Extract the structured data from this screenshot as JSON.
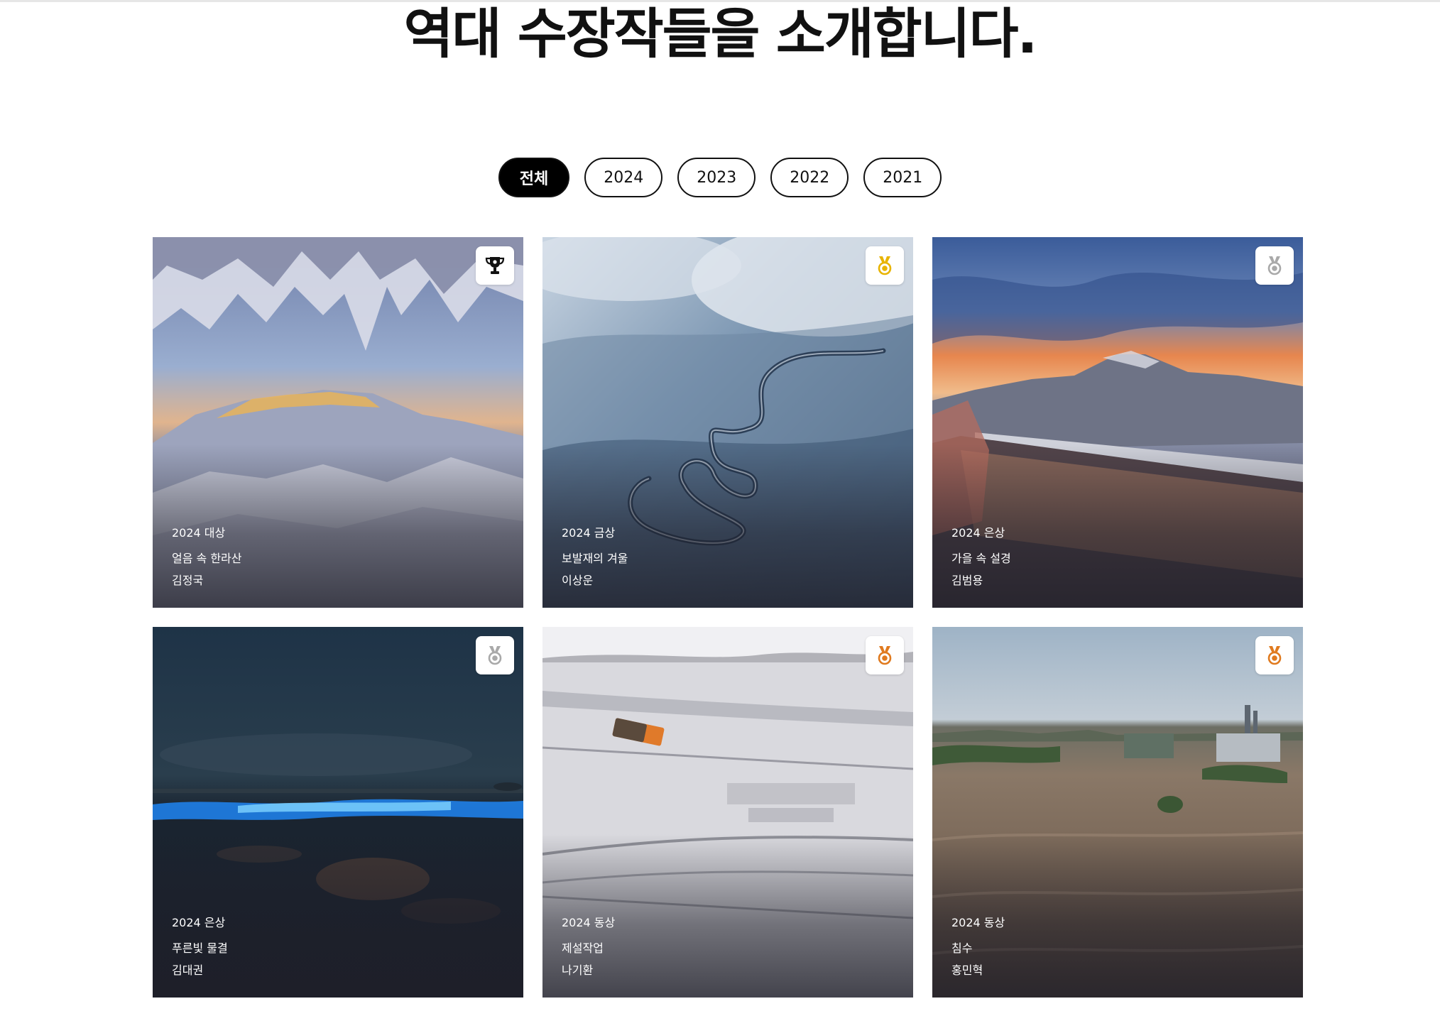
{
  "header": {
    "title": "역대 수장작들을 소개합니다."
  },
  "filters": [
    {
      "label": "전체",
      "active": true
    },
    {
      "label": "2024",
      "active": false
    },
    {
      "label": "2023",
      "active": false
    },
    {
      "label": "2022",
      "active": false
    },
    {
      "label": "2021",
      "active": false
    }
  ],
  "cards": [
    {
      "award": "2024 대상",
      "title": "얼음 속 한라산",
      "author": "김정국",
      "badge_icon": "trophy-icon",
      "badge_color": "#111111"
    },
    {
      "award": "2024 금상",
      "title": "보발재의 겨울",
      "author": "이상운",
      "badge_icon": "gold-medal-icon",
      "badge_color": "#e8b400"
    },
    {
      "award": "2024 은상",
      "title": "가을 속 설경",
      "author": "김범용",
      "badge_icon": "silver-medal-icon",
      "badge_color": "#a9a9a9"
    },
    {
      "award": "2024 은상",
      "title": "푸른빛 물결",
      "author": "김대권",
      "badge_icon": "silver-medal-icon",
      "badge_color": "#a9a9a9"
    },
    {
      "award": "2024 동상",
      "title": "제설작업",
      "author": "나기환",
      "badge_icon": "bronze-medal-icon",
      "badge_color": "#e07a1f"
    },
    {
      "award": "2024 동상",
      "title": "침수",
      "author": "홍민혁",
      "badge_icon": "bronze-medal-icon",
      "badge_color": "#e07a1f"
    }
  ]
}
